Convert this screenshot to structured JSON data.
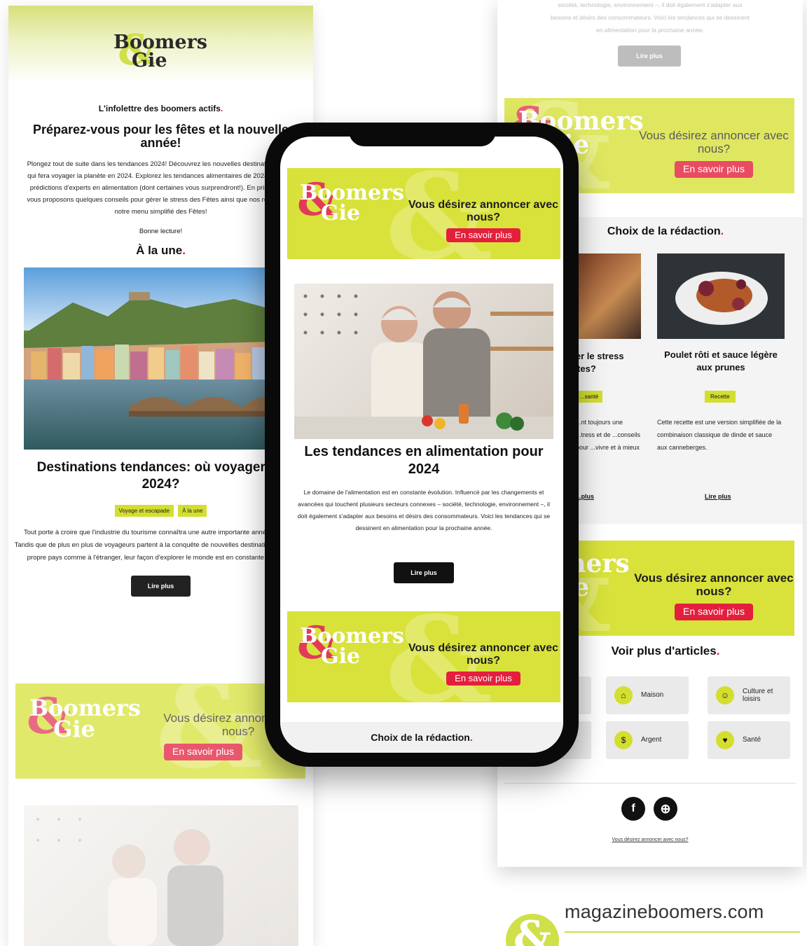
{
  "brand": {
    "line1": "Boomers",
    "line2": "Gie",
    "amp": "&"
  },
  "colors": {
    "lime": "#d8e23a",
    "accent_red": "#e41f3d",
    "dark": "#222222"
  },
  "left": {
    "tagline": "L'infolettre des boomers actifs",
    "tagline_dot": ".",
    "headline": "Préparez-vous pour les fêtes et la nouvelle année!",
    "intro": "Plongez tout de suite dans les tendances 2024! Découvrez les nouvelles destinations et ce qui fera voyager la planète en 2024. Explorez les tendances alimentaires de 2024 avec les prédictions d'experts en alimentation (dont certaines vous surprendront!). En prime, nous vous proposons quelques conseils pour gérer le stress des Fêtes ainsi que nos recettes de notre menu simplifié des Fêtes!",
    "greeting": "Bonne lecture!",
    "section_title": "À la une",
    "section_dot": ".",
    "article_title": "Destinations tendances: où voyager en 2024?",
    "tags": [
      "Voyage et escapade",
      "À la une"
    ],
    "article_text": "Tout porte à croire que l'industrie du tourisme connaîtra une autre importante année en 2024. Tandis que de plus en plus de voyageurs partent à la conquête de nouvelles destinations, dans leur propre pays comme à l'étranger, leur façon d'explorer le monde est en constante évolution.",
    "read_more": "Lire plus",
    "ad_title": "Vous désirez annoncer avec nous?",
    "ad_button": "En savoir plus"
  },
  "phone": {
    "ad_title": "Vous désirez annoncer avec nous?",
    "ad_button": "En savoir plus",
    "article_title": "Les tendances en alimentation pour 2024",
    "article_text": "Le domaine de l'alimentation est en constante évolution. Influencé par les changements et avancées qui touchent plusieurs secteurs connexes – société, technologie, environnement –, il doit également s'adapter aux besoins et désirs des consommateurs. Voici les tendances qui se dessinent en alimentation pour la prochaine année.",
    "read_more": "Lire plus",
    "ad2_title": "Vous désirez annoncer avec nous?",
    "ad2_button": "En savoir plus",
    "section_title": "Choix de la rédaction",
    "section_dot": "."
  },
  "right": {
    "faded_text_1": "société, technologie, environnement –, il doit également s'adapter aux",
    "faded_text_2": "besoins et désirs des consommateurs. Voici les tendances qui se dessinent",
    "faded_text_3": "en alimentation pour la prochaine année.",
    "faded_button": "Lire plus",
    "ad_title": "Vous désirez annoncer avec nous?",
    "ad_button": "En savoir plus",
    "choix_title": "Choix de la rédaction",
    "choix_dot": ".",
    "card1": {
      "title": "...rer le stress ...êtes?",
      "tag": "...santé",
      "text": "...nt toujours une ...tress et de ...conseils pour ...vivre et à mieux",
      "link": "...plus"
    },
    "card2": {
      "title": "Poulet rôti et sauce légère aux prunes",
      "tag": "Recette",
      "text": "Cette recette est une version simplifiée de la combinaison classique de dinde et sauce aux canneberges.",
      "link": "Lire plus"
    },
    "ad2_title": "Vous désirez annoncer avec nous?",
    "ad2_button": "En savoir plus",
    "more_title": "Voir plus d'articles",
    "more_dot": ".",
    "categories": [
      "Maison",
      "Culture et loisirs",
      "Argent",
      "Santé"
    ],
    "footer_link": "Vous désirez annoncer avec nous?"
  },
  "site_url": "magazineboomers.com"
}
